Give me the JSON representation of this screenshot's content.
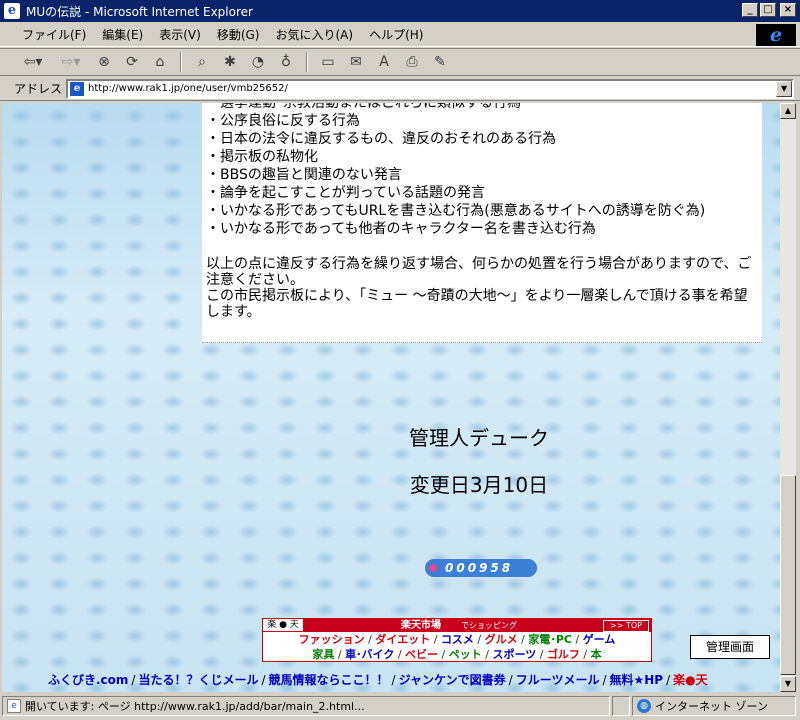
{
  "window": {
    "title": "MUの伝説 - Microsoft Internet Explorer",
    "icon_name": "ie-window-icon",
    "controls": [
      "minimize",
      "maximize",
      "close"
    ]
  },
  "menu": {
    "items": [
      "ファイル(F)",
      "編集(E)",
      "表示(V)",
      "移動(G)",
      "お気に入り(A)",
      "ヘルプ(H)"
    ]
  },
  "toolbar": {
    "buttons": [
      "back",
      "forward",
      "stop",
      "refresh",
      "home",
      "search",
      "favorites",
      "history",
      "channels",
      "fullscreen",
      "mail",
      "font",
      "print",
      "edit"
    ]
  },
  "address": {
    "label": "アドレス",
    "url": "http://www.rak1.jp/one/user/vmb25652/"
  },
  "page": {
    "rules": [
      "・選挙運動･宗教活動またはこれらに類似する行為",
      "・公序良俗に反する行為",
      "・日本の法令に違反するもの、違反のおそれのある行為",
      "・掲示板の私物化",
      "・BBSの趣旨と関連のない発言",
      "・論争を起こすことが判っている話題の発言",
      "・いかなる形であってもURLを書き込む行為(悪意あるサイトへの誘導を防ぐ為)",
      "・いかなる形であっても他者のキャラクター名を書き込む行為"
    ],
    "notice1": "以上の点に違反する行為を繰り返す場合、何らかの処置を行う場合がありますので、ご注意ください。",
    "notice2": "この市民掲示板により、「ミュー ～奇蹟の大地～」をより一層楽しんで頂ける事を希望します。",
    "admin_name": "管理人デューク",
    "update_date": "変更日3月10日",
    "counter": "000958"
  },
  "rakuten": {
    "logo": "楽 ● 天",
    "title": "楽天市場",
    "subtitle": "でショッピング",
    "top": ">> TOP",
    "row1": [
      "ファッション",
      "ダイエット",
      "コスメ",
      "グルメ",
      "家電･PC",
      "ゲーム"
    ],
    "row2": [
      "家具",
      "車･バイク",
      "ベビー",
      "ペット",
      "スポーツ",
      "ゴルフ",
      "本"
    ]
  },
  "admin_button": "管理画面",
  "bottom_links": [
    "ふくびき.com",
    "当たる！？くじメール",
    "競馬情報ならここ！！",
    "ジャンケンで図書券",
    "フルーツメール",
    "無料★HP",
    "楽●天"
  ],
  "status": {
    "text": "開いています: ページ http://www.rak1.jp/add/bar/main_2.html...",
    "zone": "インターネット ゾーン"
  },
  "colors": {
    "titlebar": "#0a246a",
    "rakuten_red": "#c8001e",
    "link_blue": "#0000c0"
  }
}
